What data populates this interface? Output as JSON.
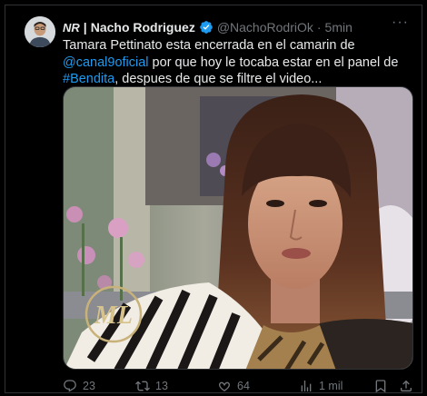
{
  "tweet": {
    "badge": "NR",
    "separator": "|",
    "author_name": "Nacho Rodriguez",
    "handle": "@NachoRodriOk",
    "dot": "·",
    "time": "5min",
    "more": "···",
    "text_part1": "Tamara Pettinato esta encerrada en el camarin de ",
    "mention": "@canal9oficial",
    "text_part2": " por que hoy le tocaba estar en el panel de ",
    "hashtag": "#Bendita",
    "text_part3": ", despues de que se filtre el video...",
    "media_watermark": "ML",
    "actions": {
      "replies": "23",
      "reposts": "13",
      "likes": "64",
      "views": "1 mil"
    }
  },
  "colors": {
    "background": "#000000",
    "text": "#e7e9ea",
    "muted": "#71767b",
    "link": "#1d9bf0",
    "verified": "#1d9bf0"
  },
  "icons": [
    "more-icon",
    "verified-icon",
    "reply-icon",
    "repost-icon",
    "like-icon",
    "views-icon",
    "bookmark-icon",
    "share-icon"
  ]
}
